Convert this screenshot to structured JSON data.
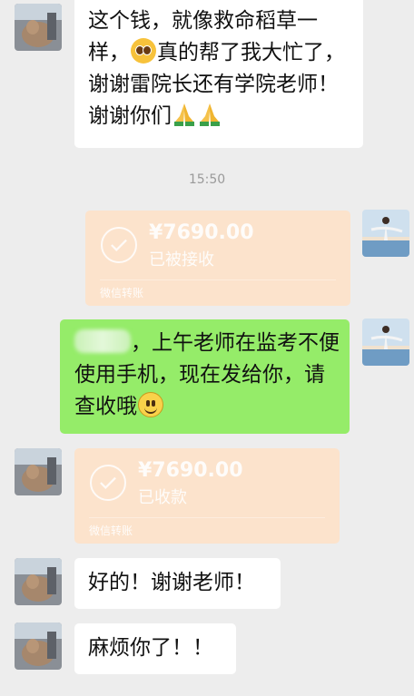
{
  "messages": {
    "m1": {
      "line1": "这个钱，就像救命稻草一",
      "line2a": "样，",
      "line2b": "真的帮了我大忙了，",
      "line3": "谢谢雷院长还有学院老师！",
      "line4": "谢谢你们"
    },
    "timestamp": "15:50",
    "transfer_sent": {
      "amount": "¥7690.00",
      "status": "已被接收",
      "footer": "微信转账"
    },
    "m2": {
      "line1": "，上午老师在监考不便",
      "line2": "使用手机，现在发给你，请",
      "line3": "查收哦"
    },
    "transfer_received": {
      "amount": "¥7690.00",
      "status": "已收款",
      "footer": "微信转账"
    },
    "m3": {
      "text": "好的！谢谢老师！"
    },
    "m4": {
      "text": "麻烦你了！！"
    }
  },
  "emoji": {
    "m1_inline": "pleading-face-emoji",
    "m1_end": "folded-hands-emoji",
    "m2_end": "smiling-face-emoji"
  },
  "colors": {
    "background": "#ededed",
    "outgoing_bubble": "#95ec69",
    "incoming_bubble": "#ffffff",
    "transfer_card": "#fce3cc"
  }
}
